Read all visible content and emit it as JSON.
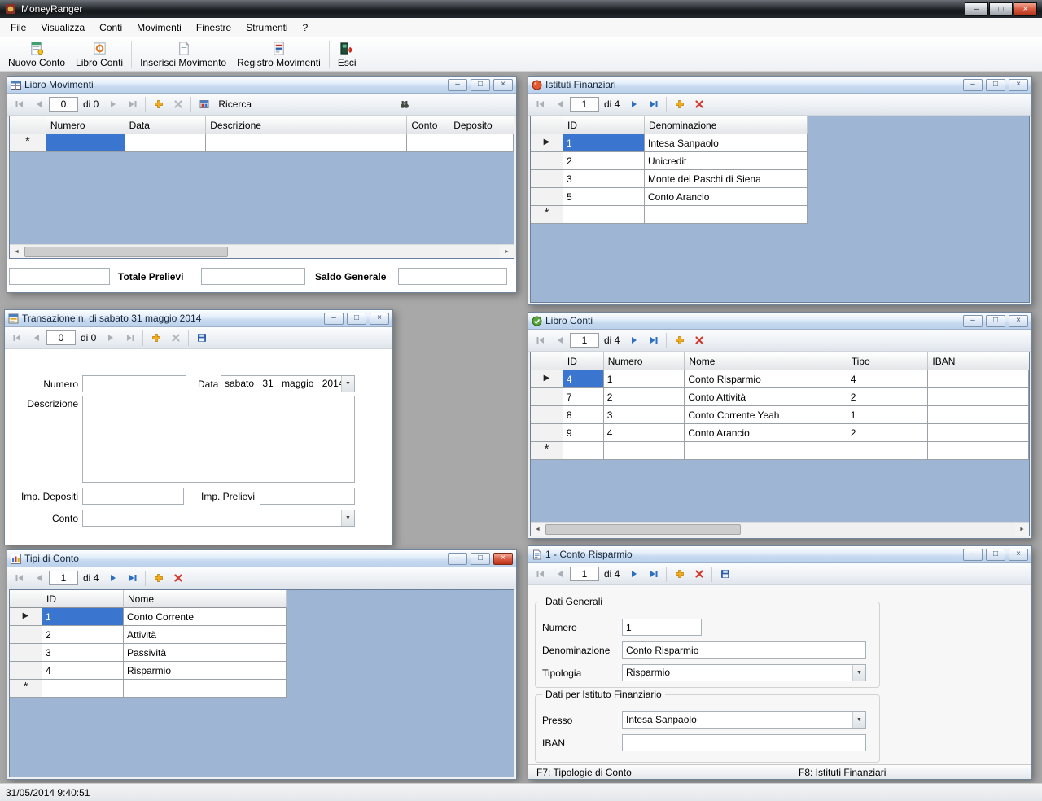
{
  "app": {
    "title": "MoneyRanger",
    "status": "31/05/2014 9:40:51"
  },
  "icons": {
    "minimize": "–",
    "maximize": "□",
    "close": "×",
    "dropdown": "▼",
    "current_row": "▶",
    "new_row": "*",
    "scroll_left": "◄",
    "scroll_right": "►"
  },
  "colors": {
    "selection": "#3a76cf",
    "grid_background": "#9eb6d3"
  },
  "menu": {
    "items": [
      "File",
      "Visualizza",
      "Conti",
      "Movimenti",
      "Finestre",
      "Strumenti",
      "?"
    ]
  },
  "toolbar": {
    "buttons": [
      "Nuovo Conto",
      "Libro Conti",
      "Inserisci Movimento",
      "Registro Movimenti",
      "Esci"
    ]
  },
  "libro_movimenti": {
    "title": "Libro Movimenti",
    "position": "0",
    "count_label": "di 0",
    "ricerca_label": "Ricerca",
    "columns": [
      "Numero",
      "Data",
      "Descrizione",
      "Conto",
      "Deposito"
    ],
    "totale_prelievi_label": "Totale Prelievi",
    "saldo_generale_label": "Saldo Generale"
  },
  "istituti_finanziari": {
    "title": "Istituti Finanziari",
    "position": "1",
    "count_label": "di 4",
    "columns": [
      "ID",
      "Denominazione"
    ],
    "rows": [
      {
        "id": "1",
        "denominazione": "Intesa Sanpaolo"
      },
      {
        "id": "2",
        "denominazione": "Unicredit"
      },
      {
        "id": "3",
        "denominazione": "Monte dei Paschi di Siena"
      },
      {
        "id": "5",
        "denominazione": "Conto Arancio"
      }
    ]
  },
  "transazione": {
    "title": "Transazione n.  di sabato 31 maggio 2014",
    "position": "0",
    "count_label": "di 0",
    "numero_label": "Numero",
    "data_label": "Data",
    "data_value": "sabato 31 maggio 2014",
    "descrizione_label": "Descrizione",
    "imp_depositi_label": "Imp. Depositi",
    "imp_prelievi_label": "Imp. Prelievi",
    "conto_label": "Conto"
  },
  "libro_conti": {
    "title": "Libro Conti",
    "position": "1",
    "count_label": "di 4",
    "columns": [
      "ID",
      "Numero",
      "Nome",
      "Tipo",
      "IBAN"
    ],
    "rows": [
      {
        "id": "4",
        "numero": "1",
        "nome": "Conto Risparmio",
        "tipo": "4",
        "iban": ""
      },
      {
        "id": "7",
        "numero": "2",
        "nome": "Conto Attività",
        "tipo": "2",
        "iban": ""
      },
      {
        "id": "8",
        "numero": "3",
        "nome": "Conto Corrente Yeah",
        "tipo": "1",
        "iban": ""
      },
      {
        "id": "9",
        "numero": "4",
        "nome": "Conto Arancio",
        "tipo": "2",
        "iban": ""
      }
    ]
  },
  "tipi_di_conto": {
    "title": "Tipi di Conto",
    "position": "1",
    "count_label": "di 4",
    "columns": [
      "ID",
      "Nome"
    ],
    "rows": [
      {
        "id": "1",
        "nome": "Conto Corrente"
      },
      {
        "id": "2",
        "nome": "Attività"
      },
      {
        "id": "3",
        "nome": "Passività"
      },
      {
        "id": "4",
        "nome": "Risparmio"
      }
    ]
  },
  "conto_risparmio": {
    "title": "1 - Conto Risparmio",
    "position": "1",
    "count_label": "di 4",
    "dati_generali_label": "Dati Generali",
    "numero_label": "Numero",
    "numero_value": "1",
    "denominazione_label": "Denominazione",
    "denominazione_value": "Conto Risparmio",
    "tipologia_label": "Tipologia",
    "tipologia_value": "Risparmio",
    "dati_istituto_label": "Dati per Istituto Finanziario",
    "presso_label": "Presso",
    "presso_value": "Intesa Sanpaolo",
    "iban_label": "IBAN",
    "iban_value": "",
    "footer_f7": "F7: Tipologie di Conto",
    "footer_f8": "F8: Istituti Finanziari"
  }
}
